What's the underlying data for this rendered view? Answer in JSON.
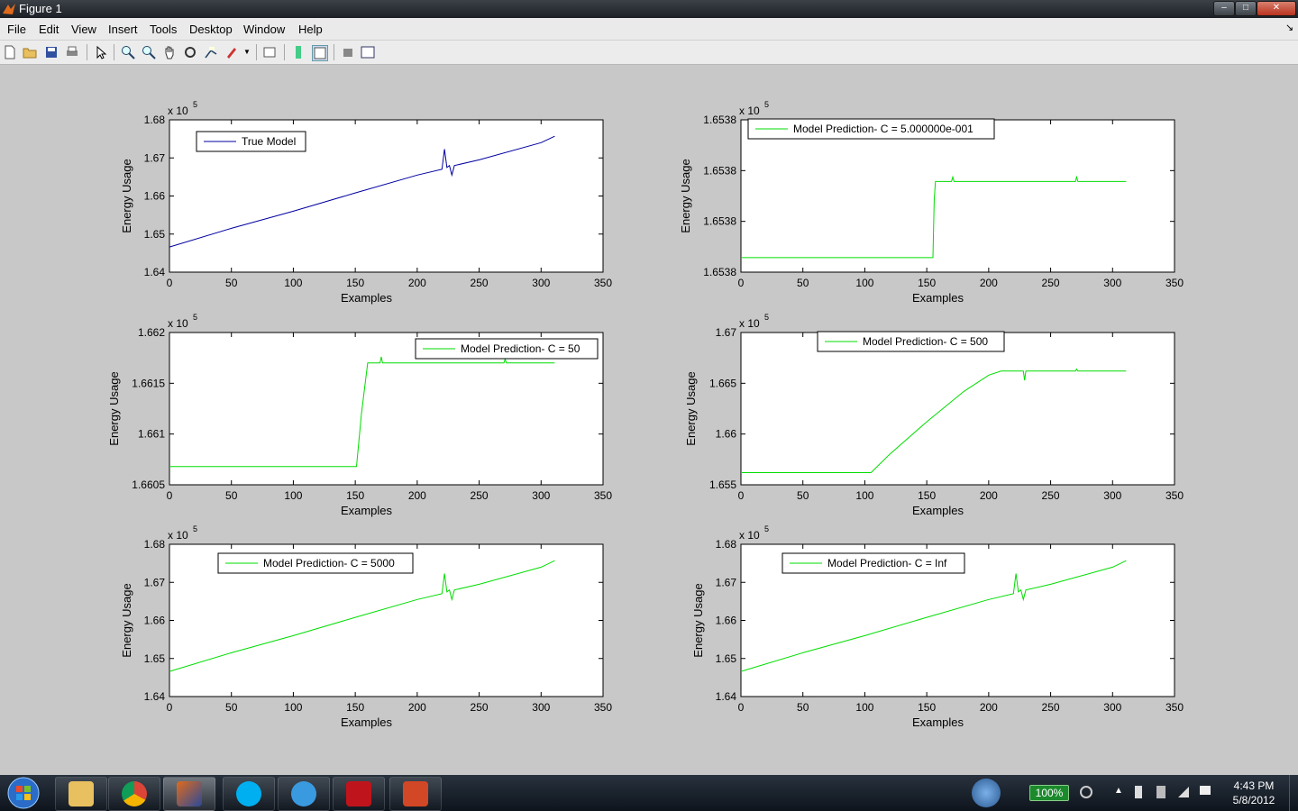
{
  "window": {
    "title": "Figure 1"
  },
  "menu": [
    "File",
    "Edit",
    "View",
    "Insert",
    "Tools",
    "Desktop",
    "Window",
    "Help"
  ],
  "toolbar_icons": [
    "new-figure-icon",
    "open-file-icon",
    "save-icon",
    "print-icon",
    "edit-plot-arrow-icon",
    "zoom-in-icon",
    "zoom-out-icon",
    "pan-icon",
    "rotate-3d-icon",
    "data-cursor-icon",
    "brush-icon",
    "link-plot-icon",
    "insert-colorbar-icon",
    "insert-legend-icon",
    "hide-plot-tools-icon",
    "show-plot-tools-icon"
  ],
  "chart_data": [
    {
      "type": "line",
      "legend": "True Model",
      "legend_placement": "top-left",
      "color": "#0000a0",
      "xlabel": "Examples",
      "ylabel": "Energy Usage",
      "exponent": "x 10",
      "exponent_power": "5",
      "xlim": [
        0,
        350
      ],
      "ylim": [
        1.64,
        1.68
      ],
      "xticks": [
        "0",
        "50",
        "100",
        "150",
        "200",
        "250",
        "300",
        "350"
      ],
      "yticks": [
        "1.64",
        "1.65",
        "1.66",
        "1.67",
        "1.68"
      ],
      "x": [
        0,
        50,
        100,
        150,
        200,
        220,
        222,
        224,
        226,
        228,
        230,
        250,
        300,
        311
      ],
      "y": [
        1.6466,
        1.6515,
        1.656,
        1.6608,
        1.6655,
        1.667,
        1.6723,
        1.6675,
        1.668,
        1.6655,
        1.668,
        1.6695,
        1.674,
        1.6757
      ]
    },
    {
      "type": "line",
      "legend": "Model Prediction- C = 5.000000e-001",
      "legend_placement": "top-left",
      "color": "#00dd00",
      "xlabel": "Examples",
      "ylabel": "Energy Usage",
      "exponent": "x 10",
      "exponent_power": "5",
      "xlim": [
        0,
        350
      ],
      "ylim": [
        0,
        4
      ],
      "xticks": [
        "0",
        "50",
        "100",
        "150",
        "200",
        "250",
        "300",
        "350"
      ],
      "yticks": [
        "1.6538",
        "1.6538",
        "1.6538",
        "1.6538"
      ],
      "x": [
        0,
        155,
        156,
        157,
        170,
        171,
        172,
        270,
        271,
        272,
        311
      ],
      "y": [
        0.38,
        0.38,
        1.9,
        2.38,
        2.38,
        2.5,
        2.38,
        2.38,
        2.5,
        2.38,
        2.38
      ]
    },
    {
      "type": "line",
      "legend": "Model Prediction- C = 50",
      "legend_placement": "top-right",
      "color": "#00dd00",
      "xlabel": "Examples",
      "ylabel": "Energy Usage",
      "exponent": "x 10",
      "exponent_power": "5",
      "xlim": [
        0,
        350
      ],
      "ylim": [
        1.6605,
        1.662
      ],
      "xticks": [
        "0",
        "50",
        "100",
        "150",
        "200",
        "250",
        "300",
        "350"
      ],
      "yticks": [
        "1.6605",
        "1.661",
        "1.6615",
        "1.662"
      ],
      "x": [
        0,
        151,
        155,
        160,
        170,
        171,
        172,
        270,
        271,
        272,
        311
      ],
      "y": [
        1.66068,
        1.66068,
        1.6612,
        1.6617,
        1.6617,
        1.66176,
        1.6617,
        1.6617,
        1.66174,
        1.6617,
        1.6617
      ],
      "note_points": "same sample index domain as other panels"
    },
    {
      "type": "line",
      "legend": "Model Prediction- C = 500",
      "legend_placement": "top-center",
      "color": "#00dd00",
      "xlabel": "Examples",
      "ylabel": "Energy Usage",
      "exponent": "x 10",
      "exponent_power": "5",
      "xlim": [
        0,
        350
      ],
      "ylim": [
        1.655,
        1.67
      ],
      "xticks": [
        "0",
        "50",
        "100",
        "150",
        "200",
        "250",
        "300",
        "350"
      ],
      "yticks": [
        "1.655",
        "1.66",
        "1.665",
        "1.67"
      ],
      "x": [
        0,
        105,
        120,
        150,
        180,
        200,
        210,
        228,
        229,
        230,
        270,
        271,
        272,
        311
      ],
      "y": [
        1.6562,
        1.6562,
        1.658,
        1.6612,
        1.6642,
        1.6658,
        1.6662,
        1.6662,
        1.6653,
        1.6662,
        1.6662,
        1.6664,
        1.6662,
        1.6662
      ]
    },
    {
      "type": "line",
      "legend": "Model Prediction- C = 5000",
      "legend_placement": "top-left",
      "color": "#00dd00",
      "xlabel": "Examples",
      "ylabel": "Energy Usage",
      "exponent": "x 10",
      "exponent_power": "5",
      "xlim": [
        0,
        350
      ],
      "ylim": [
        1.64,
        1.68
      ],
      "xticks": [
        "0",
        "50",
        "100",
        "150",
        "200",
        "250",
        "300",
        "350"
      ],
      "yticks": [
        "1.64",
        "1.65",
        "1.66",
        "1.67",
        "1.68"
      ],
      "x": [
        0,
        50,
        100,
        150,
        200,
        220,
        222,
        224,
        226,
        228,
        230,
        250,
        300,
        311
      ],
      "y": [
        1.6466,
        1.6515,
        1.656,
        1.6608,
        1.6655,
        1.667,
        1.6723,
        1.6675,
        1.668,
        1.6655,
        1.668,
        1.6695,
        1.674,
        1.6757
      ]
    },
    {
      "type": "line",
      "legend": "Model Prediction- C = Inf",
      "legend_placement": "top-left",
      "color": "#00dd00",
      "xlabel": "Examples",
      "ylabel": "Energy Usage",
      "exponent": "x 10",
      "exponent_power": "5",
      "xlim": [
        0,
        350
      ],
      "ylim": [
        1.64,
        1.68
      ],
      "xticks": [
        "0",
        "50",
        "100",
        "150",
        "200",
        "250",
        "300",
        "350"
      ],
      "yticks": [
        "1.64",
        "1.65",
        "1.66",
        "1.67",
        "1.68"
      ],
      "x": [
        0,
        50,
        100,
        150,
        200,
        220,
        222,
        224,
        226,
        228,
        230,
        250,
        300,
        311
      ],
      "y": [
        1.6466,
        1.6515,
        1.656,
        1.6608,
        1.6655,
        1.667,
        1.6723,
        1.6675,
        1.668,
        1.6655,
        1.668,
        1.6695,
        1.674,
        1.6757
      ]
    }
  ],
  "taskbar": {
    "apps": [
      "windows-explorer-icon",
      "chrome-icon",
      "matlab-icon",
      "skype-icon",
      "itunes-icon",
      "acrobat-icon",
      "powerpoint-icon"
    ],
    "battery": "100%",
    "time": "4:43 PM",
    "date": "5/8/2012"
  }
}
